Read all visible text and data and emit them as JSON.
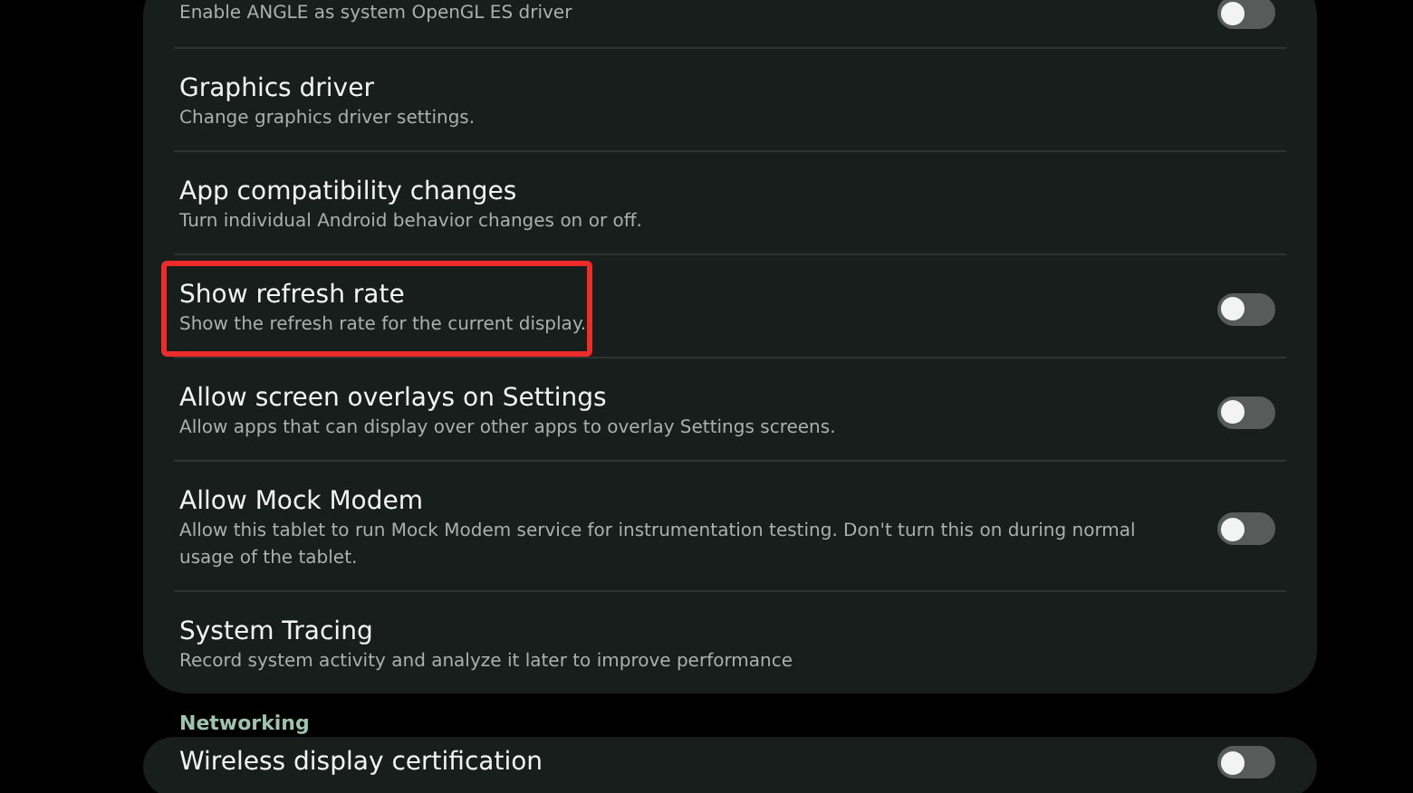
{
  "sections": [
    {
      "items": [
        {
          "subtitle": "Enable ANGLE as system OpenGL ES driver",
          "kind": "toggle",
          "on": false
        },
        {
          "title": "Graphics driver",
          "subtitle": "Change graphics driver settings.",
          "kind": "link"
        },
        {
          "title": "App compatibility changes",
          "subtitle": "Turn individual Android behavior changes on or off.",
          "kind": "link"
        },
        {
          "title": "Show refresh rate",
          "subtitle": "Show the refresh rate for the current display.",
          "kind": "toggle",
          "on": false,
          "highlighted": true
        },
        {
          "title": "Allow screen overlays on Settings",
          "subtitle": "Allow apps that can display over other apps to overlay Settings screens.",
          "kind": "toggle",
          "on": false
        },
        {
          "title": "Allow Mock Modem",
          "subtitle": "Allow this tablet to run Mock Modem service for instrumentation testing. Don't turn this on during normal usage of the tablet.",
          "kind": "toggle",
          "on": false
        },
        {
          "title": "System Tracing",
          "subtitle": "Record system activity and analyze it later to improve performance",
          "kind": "link"
        }
      ]
    },
    {
      "header": "Networking",
      "items": [
        {
          "title": "Wireless display certification",
          "kind": "toggle",
          "on": false
        }
      ]
    }
  ]
}
